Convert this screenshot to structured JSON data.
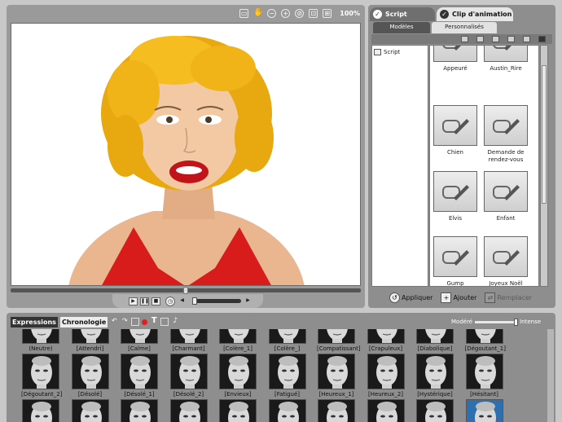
{
  "viewer": {
    "zoom_label": "100%",
    "toolbar_icons": [
      "fit-icon",
      "hand-icon",
      "zoom-out-icon",
      "zoom-in-icon",
      "no-zoom-icon",
      "zoom-box-icon",
      "zoom-fit-icon"
    ]
  },
  "scene": {
    "hair_color": "#f0b418",
    "skin_color": "#f2c9a2",
    "dress_color": "#d81c1c"
  },
  "transport": {
    "buttons": [
      "play-icon",
      "pause-icon",
      "stop-icon"
    ],
    "volume_level": 0
  },
  "right_panel": {
    "tabs": {
      "script": "Script",
      "clip": "Clip d'animation"
    },
    "subtabs": {
      "models": "Modèles",
      "custom": "Personnalisés"
    },
    "tree": {
      "item": "Script"
    },
    "tiles": [
      {
        "label": "Appeuré"
      },
      {
        "label": "Austin_Rire"
      },
      {
        "label": "Chien"
      },
      {
        "label": "Demande de rendez-vous"
      },
      {
        "label": "Elvis"
      },
      {
        "label": "Enfant"
      },
      {
        "label": "Gump"
      },
      {
        "label": "Joyeux Noël"
      }
    ],
    "actions": {
      "apply": "Appliquer",
      "add": "Ajouter",
      "replace": "Remplacer"
    }
  },
  "expressions": {
    "tabs": {
      "expressions": "Expressions",
      "timeline": "Chronologie"
    },
    "slider": {
      "min_label": "Modéré",
      "max_label": "Intense",
      "level": 1.0
    },
    "row1": [
      "(Neutre)",
      "[Attendri]",
      "[Calme]",
      "[Charmant]",
      "[Colère_1]",
      "[Colère_]",
      "[Compatissant]",
      "[Crapuleux]",
      "[Diabolique]",
      "[Dégoutant_1]"
    ],
    "row2": [
      "[Dégoutant_2]",
      "[Désolé]",
      "[Désolé_1]",
      "[Désolé_2]",
      "[Envieux]",
      "[Fatigué]",
      "[Heureux_1]",
      "[Heureux_2]",
      "[Hystérique]",
      "[Hésitant]"
    ]
  }
}
